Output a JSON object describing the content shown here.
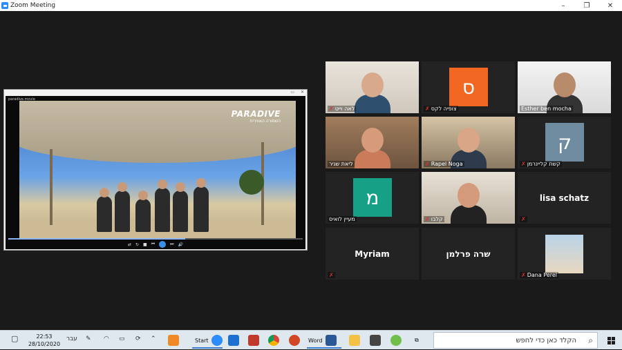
{
  "window": {
    "title": "Zoom Meeting",
    "minimize": "–",
    "maximize": "❐",
    "close": "✕"
  },
  "shared_video": {
    "filename": "paradive.movie",
    "logo_title": "PARADIVE",
    "logo_subtitle": "השמורה האווירית",
    "progress": 0.6
  },
  "participants": [
    {
      "name": "לאה וייט",
      "muted": true,
      "type": "video"
    },
    {
      "name": "צופיה לקס",
      "muted": true,
      "type": "avatar",
      "initial": "ס",
      "color": "#f26722"
    },
    {
      "name": "Esther ben mocha",
      "muted": false,
      "type": "video"
    },
    {
      "name": "ליאת שניר",
      "muted": false,
      "type": "video",
      "active": true
    },
    {
      "name": "Rapel Noga",
      "muted": true,
      "type": "video"
    },
    {
      "name": "קשת קליינרמן",
      "muted": true,
      "type": "avatar",
      "initial": "ק",
      "color": "#6f8ca0"
    },
    {
      "name": "מעיין לואיס",
      "muted": false,
      "type": "avatar",
      "initial": "מ",
      "color": "#16a085"
    },
    {
      "name": "קלבו",
      "muted": true,
      "type": "video"
    },
    {
      "name": "lisa schatz",
      "muted": true,
      "type": "name"
    },
    {
      "name": "Myriam",
      "muted": true,
      "type": "name"
    },
    {
      "name": "שרה פרלמן",
      "muted": false,
      "type": "name"
    },
    {
      "name": "Dana Perel",
      "muted": true,
      "type": "video"
    }
  ],
  "taskbar": {
    "search_placeholder": "הקלד כאן כדי לחפש",
    "start_label": "Start",
    "word_label": "Word",
    "time": "22:53",
    "date": "28/10/2020",
    "language": "עבר",
    "mute_icon": "🎤"
  }
}
